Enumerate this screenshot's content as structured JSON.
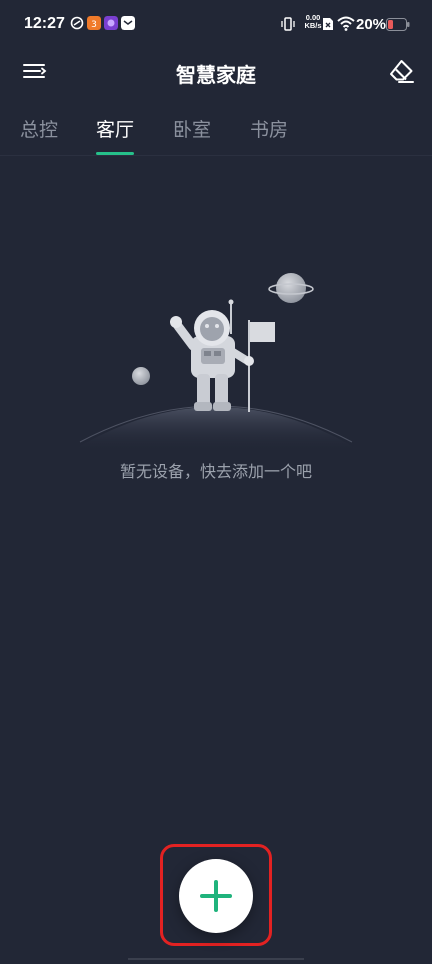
{
  "status_bar": {
    "time": "12:27",
    "net_speed_value": "0.00",
    "net_speed_unit": "KB/s",
    "battery_percent": "20%"
  },
  "app_bar": {
    "title": "智慧家庭"
  },
  "tabs": [
    {
      "label": "总控",
      "active": false
    },
    {
      "label": "客厅",
      "active": true
    },
    {
      "label": "卧室",
      "active": false
    },
    {
      "label": "书房",
      "active": false
    }
  ],
  "empty_state": {
    "message": "暂无设备，快去添加一个吧"
  },
  "colors": {
    "background": "#222736",
    "accent": "#26c08a",
    "fab_icon": "#1fb37c",
    "highlight": "#e32222",
    "battery_low": "#e85a5a"
  },
  "icons": {
    "menu": "menu-icon",
    "eraser": "eraser-icon",
    "add": "plus-icon"
  }
}
